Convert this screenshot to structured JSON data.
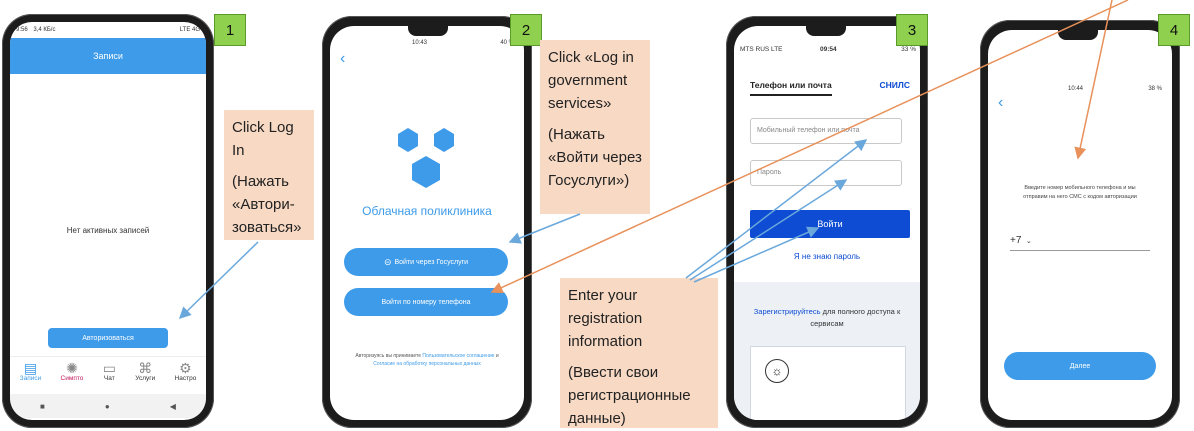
{
  "steps": [
    "1",
    "2",
    "3",
    "4"
  ],
  "phone1": {
    "status_time": "9:56",
    "status_info": "3,4 КБ/с",
    "status_right": "LTE 4G",
    "header_title": "Записи",
    "empty_text": "Нет активных записей",
    "login_button": "Авторизоваться",
    "tabs": [
      {
        "label": "Записи",
        "icon": "document-icon"
      },
      {
        "label": "Симпто",
        "icon": "virus-icon"
      },
      {
        "label": "Чат",
        "icon": "chat-icon"
      },
      {
        "label": "Услуги",
        "icon": "services-icon"
      },
      {
        "label": "Настро",
        "icon": "gear-icon"
      }
    ],
    "nav": [
      "■",
      "●",
      "◀"
    ]
  },
  "note1": {
    "lines": [
      "Click Log In"
    ],
    "lines_ru": [
      "(Нажать «Автори-зоваться»"
    ]
  },
  "phone2": {
    "status_time": "10:43",
    "status_right": "40 %",
    "back": "‹",
    "app_name": "Облачная поликлиника",
    "gosuslugi_button": "Войти через Госуслуги",
    "phone_button": "Войти по номеру телефона",
    "terms_prefix": "Авторизуясь вы принимаете",
    "terms_link1": "Пользовательское соглашение",
    "terms_and": "и",
    "terms_link2": "Согласие на обработку персональных данных"
  },
  "note2": {
    "en": "Click «Log in government services»",
    "ru": "(Нажать «Войти через Госуслуги»)"
  },
  "phone3": {
    "status_left": "MTS RUS LTE",
    "status_time": "09:54",
    "status_right": "33 %",
    "tab_active": "Телефон или почта",
    "tab_other": "СНИЛС",
    "input_phone_placeholder": "Мобильный телефон или почта",
    "input_password_placeholder": "Пароль",
    "login_button": "Войти",
    "forgot_link": "Я не знаю пароль",
    "register_link": "Зарегистрируйтесь",
    "register_text": "для полного доступа к сервисам"
  },
  "note3": {
    "en": "Enter your registration information",
    "ru": "(Ввести свои регистрационные данные)"
  },
  "phone4": {
    "status_time": "10:44",
    "status_right": "38 %",
    "back": "‹",
    "instruction": "Введите номер мобильного телефона и мы отправим на него СМС с кодом авторизации",
    "country_code": "+7",
    "next_button": "Далее"
  },
  "colors": {
    "accent": "#3d9be9",
    "note_bg": "#f7d9c4",
    "step_bg": "#8fd14f",
    "arrow_blue": "#6aa8dc",
    "arrow_orange": "#e8915a",
    "gosuslugi_blue": "#0d4cd3"
  }
}
